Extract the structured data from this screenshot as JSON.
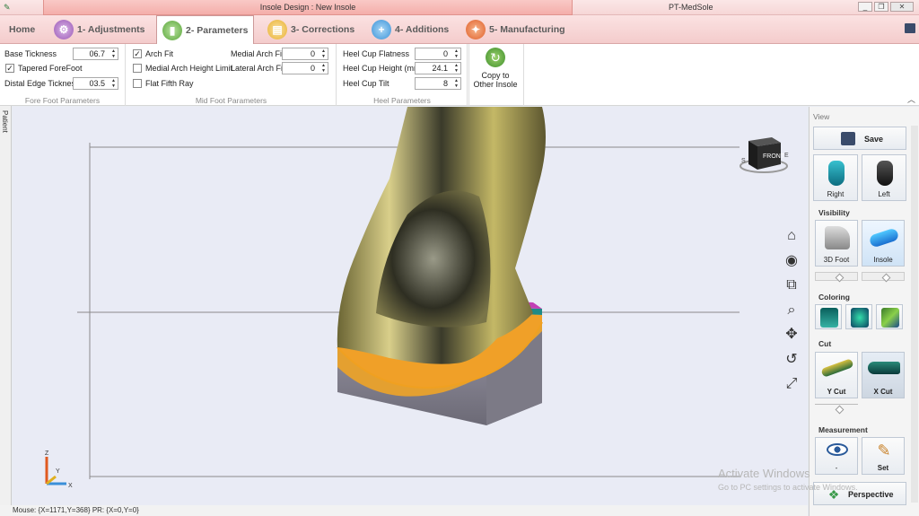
{
  "titlebar": {
    "context_title": "Insole Design : New Insole",
    "app_name": "PT-MedSole",
    "min": "_",
    "restore": "❐",
    "close": "✕"
  },
  "tabs": [
    {
      "label": "Home"
    },
    {
      "label": "1- Adjustments"
    },
    {
      "label": "2- Parameters"
    },
    {
      "label": "3- Corrections"
    },
    {
      "label": "4- Additions"
    },
    {
      "label": "5- Manufacturing"
    }
  ],
  "forefoot": {
    "base_thickness_label": "Base Tickness",
    "base_thickness_value": "06.7",
    "tapered_label": "Tapered ForeFoot",
    "tapered_checked": true,
    "distal_label": "Distal Edge Tickness",
    "distal_value": "03.5",
    "group_label": "Fore Foot Parameters"
  },
  "midfoot": {
    "arch_fit_label": "Arch Fit",
    "arch_fit_checked": true,
    "medial_height_label": "Medial Arch Height Limit",
    "flat_fifth_label": "Flat Fifth Ray",
    "medial_fill_label": "Medial Arch Fill",
    "medial_fill_value": "0",
    "lateral_fill_label": "Lateral Arch Fill",
    "lateral_fill_value": "0",
    "group_label": "Mid Foot Parameters"
  },
  "heel": {
    "flatness_label": "Heel Cup Flatness",
    "flatness_value": "0",
    "height_label": "Heel Cup Height (mm)",
    "height_value": "24.1",
    "tilt_label": "Heel Cup Tilt",
    "tilt_value": "8",
    "group_label": "Heel Parameters"
  },
  "copy_button": {
    "line1": "Copy to",
    "line2": "Other Insole"
  },
  "side_tab": "Patient",
  "status": "Mouse: {X=1171,Y=368} PR: {X=0,Y=0}",
  "viewcube": {
    "front": "FRONT",
    "s": "S",
    "e": "E"
  },
  "axes": {
    "z": "Z",
    "y": "Y",
    "x": "X"
  },
  "panel": {
    "view_title": "View",
    "save": "Save",
    "right": "Right",
    "left": "Left",
    "visibility_title": "Visibility",
    "foot3d": "3D Foot",
    "insole": "Insole",
    "coloring_title": "Coloring",
    "cut_title": "Cut",
    "ycut": "Y Cut",
    "xcut": "X Cut",
    "measurement_title": "Measurement",
    "eye_label": "-",
    "set": "Set",
    "perspective": "Perspective"
  },
  "watermark": {
    "line1": "Activate Windows",
    "line2": "Go to PC settings to activate Windows."
  },
  "colors": {
    "foot": "#b8a85a",
    "insole_orange": "#f0a028",
    "insole_teal": "#1f8a86",
    "insole_magenta": "#c23fb5",
    "block": "#8a8793"
  }
}
